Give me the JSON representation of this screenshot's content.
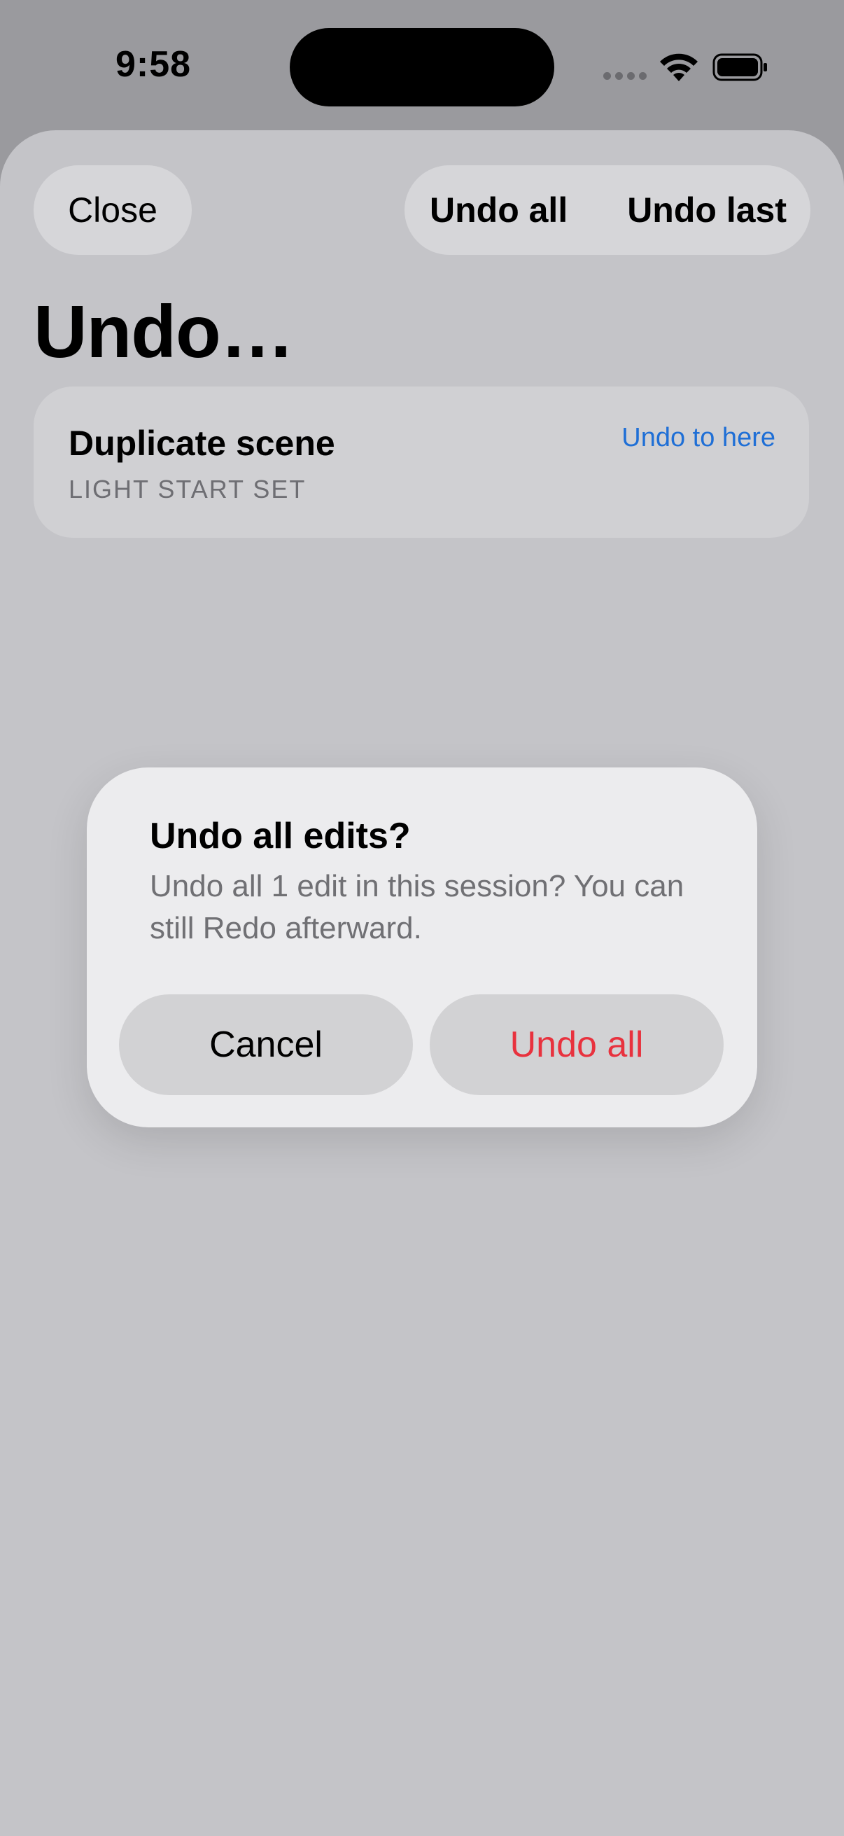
{
  "status_bar": {
    "time": "9:58",
    "icons": [
      "signal-dots-icon",
      "wifi-icon",
      "battery-icon"
    ]
  },
  "sheet": {
    "close_label": "Close",
    "undo_all_label": "Undo all",
    "undo_last_label": "Undo last",
    "title": "Undo…",
    "history": [
      {
        "title": "Duplicate scene",
        "subtitle": "LIGHT START SET",
        "action": "Undo to here"
      }
    ]
  },
  "dialog": {
    "title": "Undo all edits?",
    "message": "Undo all 1 edit in this session? You can still Redo afterward.",
    "cancel_label": "Cancel",
    "confirm_label": "Undo all"
  },
  "colors": {
    "link": "#1f6fd6",
    "destructive": "#e8323e"
  }
}
